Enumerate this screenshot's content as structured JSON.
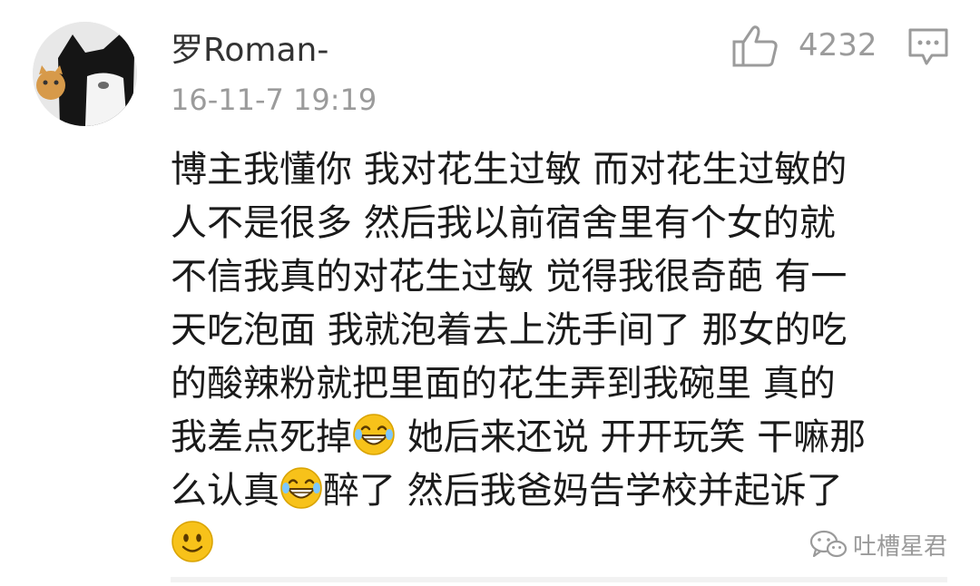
{
  "comment": {
    "username": "罗Roman-",
    "timestamp": "16-11-7 19:19",
    "like_count": "4232",
    "body_lines": [
      [
        "博主我懂你 我对花生过敏 而对花生过敏的"
      ],
      [
        "人不是很多 然后我以前宿舍里有个女的就"
      ],
      [
        "不信我真的对花生过敏 觉得我很奇葩 有一"
      ],
      [
        "天吃泡面 我就泡着去上洗手间了 那女的吃"
      ],
      [
        "的酸辣粉就把里面的花生弄到我碗里 真的"
      ],
      [
        "我差点死掉",
        " 她后来还说 开开玩笑 干嘛那"
      ],
      [
        "么认真",
        "醉了 然后我爸妈告学校并起诉了"
      ]
    ]
  },
  "icons": {
    "like": "thumbs-up-icon",
    "reply": "comment-reply-icon",
    "emoji_laugh": "grinning-tears-emoji",
    "emoji_smile": "smile-emoji",
    "watermark_logo": "wechat-icon"
  },
  "watermark": {
    "text": "吐槽星君"
  },
  "colors": {
    "text": "#1a1a1a",
    "muted": "#9b9b9b",
    "emoji_yellow": "#f7c21a"
  }
}
